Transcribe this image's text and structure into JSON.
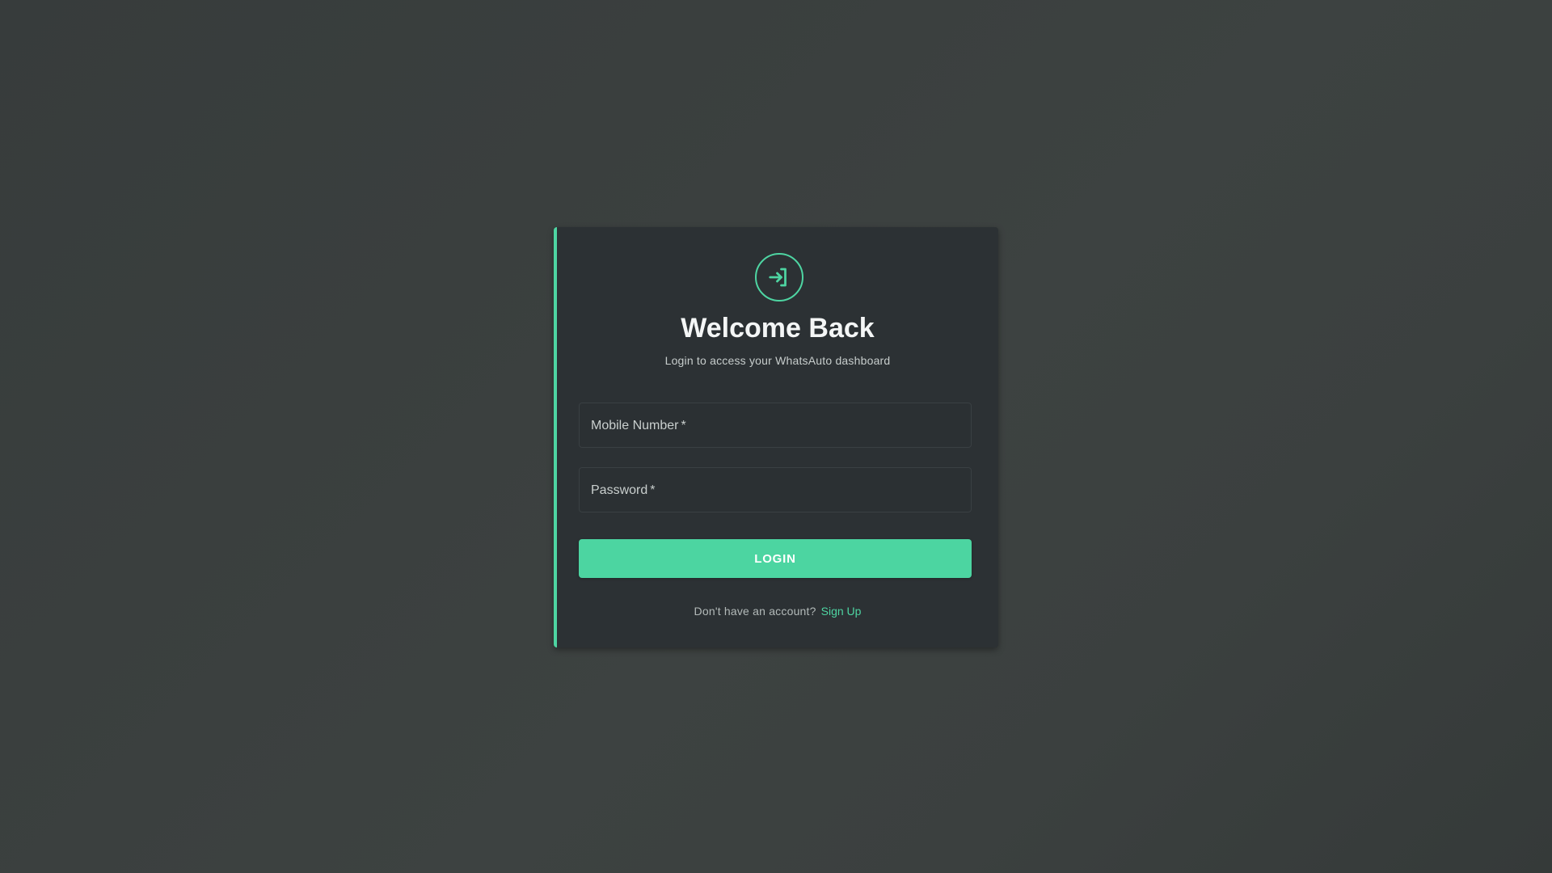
{
  "colors": {
    "accent": "#4ed5a2",
    "card_background": "#2c3134",
    "page_background": "#3b403f"
  },
  "header": {
    "icon": "login-icon",
    "title": "Welcome Back",
    "subtitle": "Login to access your WhatsAuto dashboard"
  },
  "form": {
    "mobile": {
      "label": "Mobile Number",
      "required_mark": "*",
      "value": ""
    },
    "password": {
      "label": "Password",
      "required_mark": "*",
      "value": ""
    },
    "login_label": "LOGIN"
  },
  "footer": {
    "prompt": "Don't have an account?",
    "signup_label": "Sign Up"
  }
}
